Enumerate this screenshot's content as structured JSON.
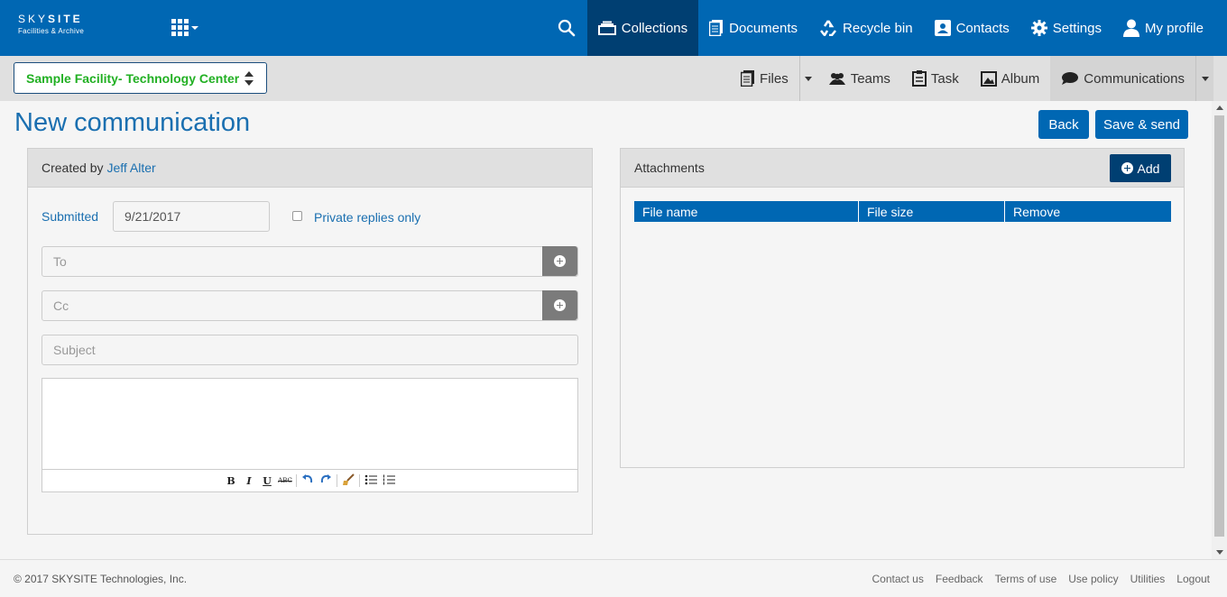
{
  "header": {
    "brand": "SKYSITE",
    "brand_sub": "Facilities & Archive",
    "nav": [
      {
        "label": "Collections",
        "icon": "collections-icon"
      },
      {
        "label": "Documents",
        "icon": "documents-icon"
      },
      {
        "label": "Recycle bin",
        "icon": "recycle-icon"
      },
      {
        "label": "Contacts",
        "icon": "contacts-icon"
      },
      {
        "label": "Settings",
        "icon": "gear-icon"
      },
      {
        "label": "My profile",
        "icon": "user-icon"
      }
    ]
  },
  "subbar": {
    "facility": "Sample Facility- Technology Center",
    "tabs": [
      {
        "label": "Files",
        "icon": "files-icon"
      },
      {
        "label": "Teams",
        "icon": "teams-icon"
      },
      {
        "label": "Task",
        "icon": "task-icon"
      },
      {
        "label": "Album",
        "icon": "album-icon"
      },
      {
        "label": "Communications",
        "icon": "chat-icon"
      }
    ]
  },
  "page": {
    "title": "New communication",
    "back_label": "Back",
    "save_label": "Save & send"
  },
  "form": {
    "created_by_label": "Created by",
    "author": "Jeff Alter",
    "submitted_label": "Submitted",
    "submitted_date": "9/21/2017",
    "private_label": "Private replies only",
    "to_placeholder": "To",
    "cc_placeholder": "Cc",
    "subject_placeholder": "Subject",
    "toolbar": [
      "B",
      "I",
      "U",
      "ABC"
    ]
  },
  "attachments": {
    "title": "Attachments",
    "add_label": "Add",
    "columns": [
      "File name",
      "File size",
      "Remove"
    ]
  },
  "footer": {
    "copyright": "© 2017 SKYSITE Technologies, Inc.",
    "links": [
      "Contact us",
      "Feedback",
      "Terms of use",
      "Use policy",
      "Utilities",
      "Logout"
    ]
  },
  "colors": {
    "primary": "#0067b3",
    "active": "#003f72",
    "facility_text": "#22b023"
  }
}
